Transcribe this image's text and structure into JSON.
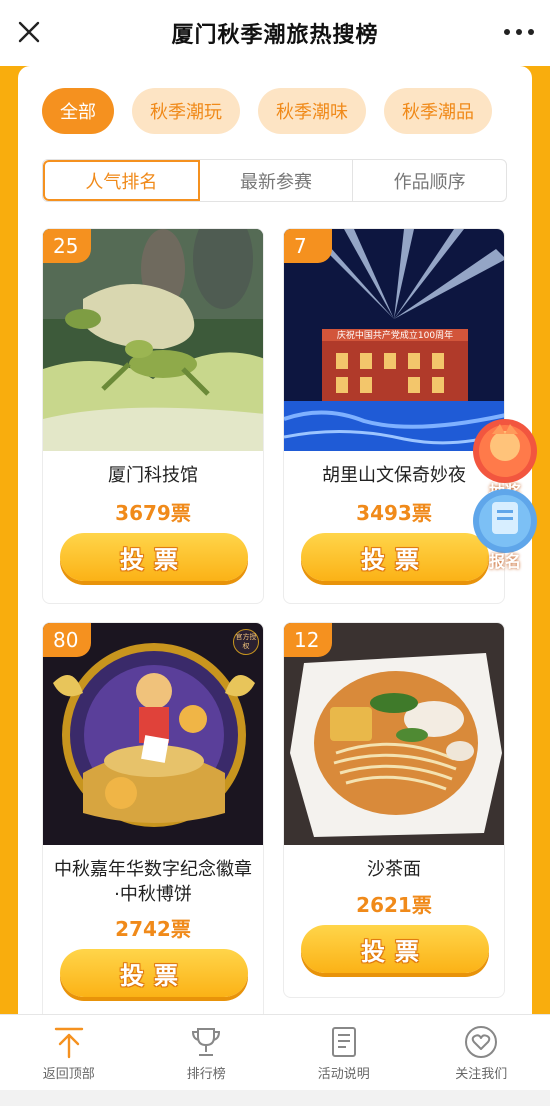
{
  "header": {
    "title": "厦门秋季潮旅热搜榜"
  },
  "categories": [
    "全部",
    "秋季潮玩",
    "秋季潮味",
    "秋季潮品"
  ],
  "sort_tabs": [
    "人气排名",
    "最新参赛",
    "作品顺序"
  ],
  "cards": [
    {
      "rank": "25",
      "name": "厦门科技馆",
      "votes": "3679票",
      "button": "投票"
    },
    {
      "rank": "7",
      "name": "胡里山文保奇妙夜",
      "votes": "3493票",
      "button": "投票",
      "banner": "庆祝中国共产党成立100周年"
    },
    {
      "rank": "80",
      "name": "中秋嘉年华数字纪念徽章·中秋博饼",
      "votes": "2742票",
      "button": "投票",
      "badge": "官方授权"
    },
    {
      "rank": "12",
      "name": "沙茶面",
      "votes": "2621票",
      "button": "投票"
    }
  ],
  "floating": {
    "lottery": "抽奖",
    "signup": "报名"
  },
  "tabbar": [
    {
      "label": "返回顶部",
      "icon": "arrow-up-icon"
    },
    {
      "label": "排行榜",
      "icon": "trophy-icon"
    },
    {
      "label": "活动说明",
      "icon": "document-icon"
    },
    {
      "label": "关注我们",
      "icon": "heart-icon"
    }
  ],
  "colors": {
    "accent": "#f5911f",
    "stage": "#f9ad0d",
    "chip_bg": "#fde4c4",
    "vote_text": "#f08a1a"
  }
}
